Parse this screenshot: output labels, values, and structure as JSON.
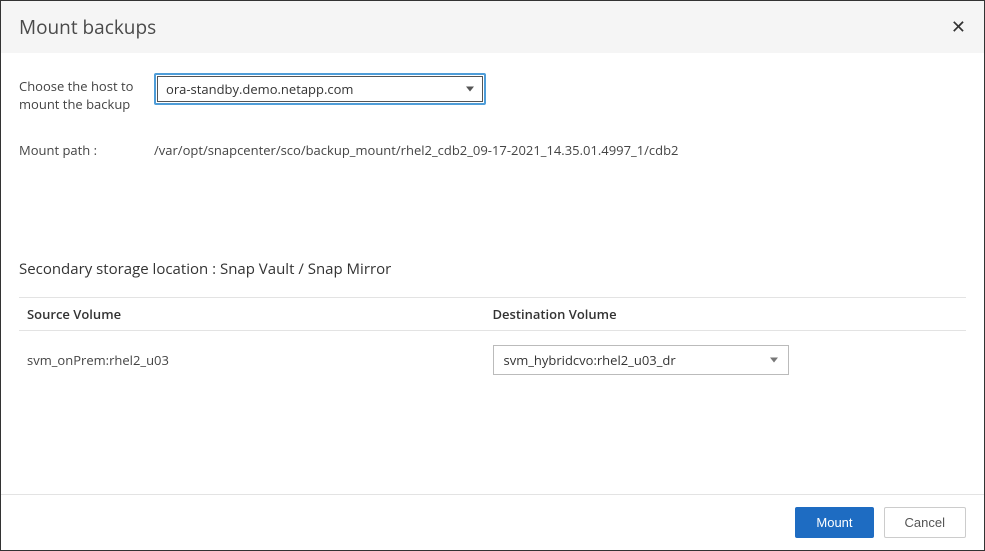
{
  "dialog": {
    "title": "Mount backups",
    "close_symbol": "✕"
  },
  "host_row": {
    "label": "Choose the host to mount the backup",
    "selected": "ora-standby.demo.netapp.com"
  },
  "path_row": {
    "label": "Mount path :",
    "value": "/var/opt/snapcenter/sco/backup_mount/rhel2_cdb2_09-17-2021_14.35.01.4997_1/cdb2"
  },
  "secondary": {
    "title": "Secondary storage location : Snap Vault / Snap Mirror",
    "col_src": "Source Volume",
    "col_dst": "Destination Volume",
    "rows": [
      {
        "source": "svm_onPrem:rhel2_u03",
        "destination": "svm_hybridcvo:rhel2_u03_dr"
      }
    ]
  },
  "footer": {
    "mount_label": "Mount",
    "cancel_label": "Cancel"
  }
}
